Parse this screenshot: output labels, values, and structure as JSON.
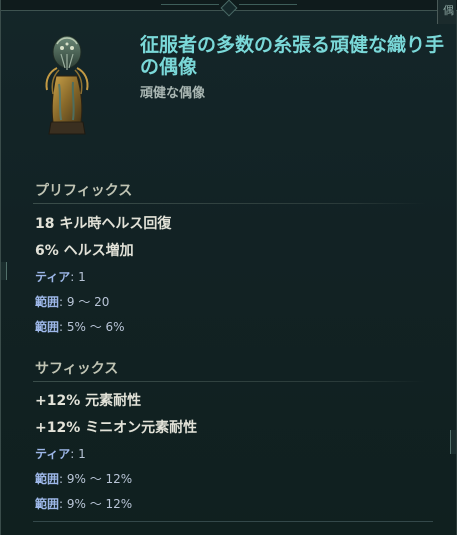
{
  "item": {
    "title": "征服者の多数の糸張る頑健な織り手の偶像",
    "subtitle": "頑健な偶像",
    "corner_glyph": "偶"
  },
  "prefixes": {
    "header": "プリフィックス",
    "stat1": "18 キル時ヘルス回復",
    "stat2": "6% ヘルス増加",
    "tier_label": "ティア",
    "tier_value": ": 1",
    "range1_label": "範囲",
    "range1_value": ": 9 〜 20",
    "range2_label": "範囲",
    "range2_value": ": 5% 〜 6%"
  },
  "suffixes": {
    "header": "サフィックス",
    "stat1": "+12% 元素耐性",
    "stat2": "+12% ミニオン元素耐性",
    "tier_label": "ティア",
    "tier_value": ": 1",
    "range1_label": "範囲",
    "range1_value": ": 9% 〜 12%",
    "range2_label": "範囲",
    "range2_value": ": 9% 〜 12%"
  },
  "colors": {
    "title": "#7ad8d8",
    "meta_key": "#9db7e8",
    "stat": "#e2e2d8",
    "background": "#122224"
  },
  "icons": {
    "item_icon": "weaver-idol-icon"
  }
}
